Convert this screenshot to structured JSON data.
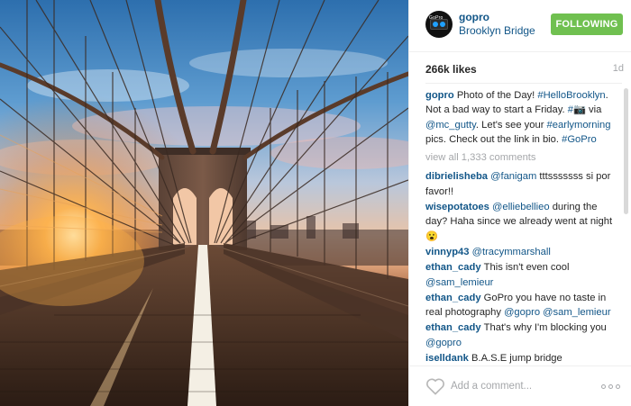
{
  "header": {
    "username": "gopro",
    "location": "Brooklyn Bridge",
    "follow_label": "FOLLOWING",
    "avatar_text": "GoPro"
  },
  "stats": {
    "likes": "266k likes",
    "time": "1d"
  },
  "caption": {
    "username": "gopro",
    "segments": [
      {
        "text": "Photo of the Day! ",
        "link": false
      },
      {
        "text": "#HelloBrooklyn",
        "link": true
      },
      {
        "text": ". Not a bad way to start a Friday. ",
        "link": false
      },
      {
        "text": "#📷",
        "link": true
      },
      {
        "text": " via ",
        "link": false
      },
      {
        "text": "@mc_gutty",
        "link": true
      },
      {
        "text": ". Let's see your ",
        "link": false
      },
      {
        "text": "#earlymorning",
        "link": true
      },
      {
        "text": " pics. Check out the link in bio. ",
        "link": false
      },
      {
        "text": "#GoPro",
        "link": true
      }
    ]
  },
  "view_all": "view all 1,333 comments",
  "comments": [
    {
      "username": "dibrielisheba",
      "segments": [
        {
          "text": "@fanigam",
          "link": true
        },
        {
          "text": " tttsssssss si por favor!!",
          "link": false
        }
      ]
    },
    {
      "username": "wisepotatoes",
      "segments": [
        {
          "text": "@elliebellieo",
          "link": true
        },
        {
          "text": " during the day? Haha since we already went at night 😮",
          "link": false
        }
      ]
    },
    {
      "username": "vinnyp43",
      "segments": [
        {
          "text": "@tracymmarshall",
          "link": true
        }
      ]
    },
    {
      "username": "ethan_cady",
      "segments": [
        {
          "text": "This isn't even cool ",
          "link": false
        },
        {
          "text": "@sam_lemieur",
          "link": true
        }
      ]
    },
    {
      "username": "ethan_cady",
      "segments": [
        {
          "text": "GoPro you have no taste in real photography ",
          "link": false
        },
        {
          "text": "@gopro",
          "link": true
        },
        {
          "text": " ",
          "link": false
        },
        {
          "text": "@sam_lemieur",
          "link": true
        }
      ]
    },
    {
      "username": "ethan_cady",
      "segments": [
        {
          "text": "That's why I'm blocking you ",
          "link": false
        },
        {
          "text": "@gopro",
          "link": true
        }
      ]
    },
    {
      "username": "iselldank",
      "segments": [
        {
          "text": "B.A.S.E jump bridge",
          "link": false
        }
      ]
    }
  ],
  "footer": {
    "comment_placeholder": "Add a comment..."
  },
  "colors": {
    "link": "#125688",
    "follow_green": "#70c050",
    "muted": "#a5a7aa"
  },
  "icons": [
    "heart-icon",
    "more-options-icon",
    "camera-emoji",
    "astonished-emoji"
  ]
}
